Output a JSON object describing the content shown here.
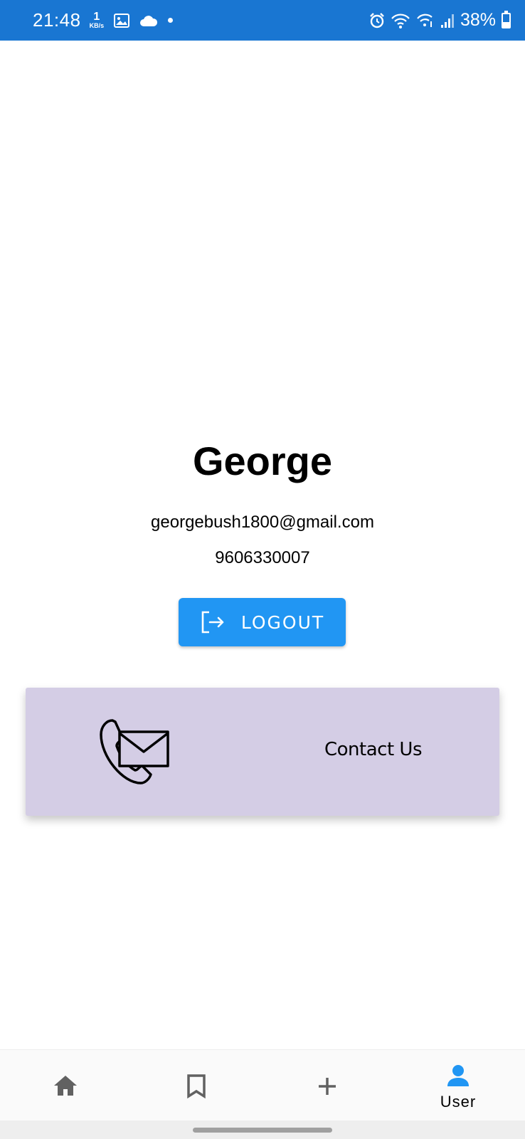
{
  "status_bar": {
    "time": "21:48",
    "network_speed_value": "1",
    "network_speed_unit": "KB/s",
    "battery_percent": "38%",
    "battery_level": 0.38,
    "icons": [
      "image-icon",
      "cloud-icon",
      "alarm-icon",
      "wifi-icon",
      "wifi-calling-icon",
      "signal-icon",
      "battery-icon"
    ]
  },
  "profile": {
    "name": "George",
    "email": "georgebush1800@gmail.com",
    "phone": "9606330007"
  },
  "logout": {
    "label": "LOGOUT",
    "icon": "logout-icon",
    "color": "#2196f3"
  },
  "contact_card": {
    "label": "Contact Us",
    "icon": "phone-mail-icon",
    "background": "#d4cde5"
  },
  "bottom_nav": {
    "items": [
      {
        "icon": "home-icon",
        "label": "",
        "active": false
      },
      {
        "icon": "bookmark-icon",
        "label": "",
        "active": false
      },
      {
        "icon": "add-icon",
        "label": "",
        "active": false
      },
      {
        "icon": "user-icon",
        "label": "User",
        "active": true
      }
    ],
    "active_color": "#2196f3",
    "inactive_color": "#616161"
  },
  "theme": {
    "status_bar_color": "#1976d2"
  }
}
